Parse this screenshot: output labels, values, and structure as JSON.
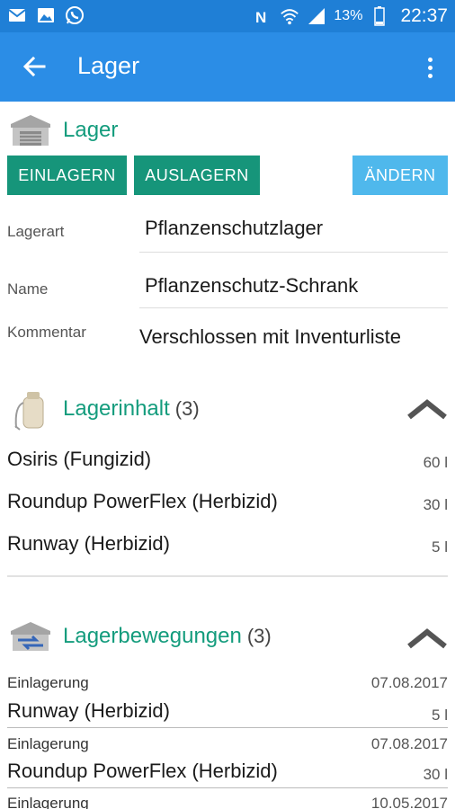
{
  "status_bar": {
    "battery": "13%",
    "time": "22:37",
    "left_icons": [
      "mail-icon",
      "image-icon",
      "whatsapp-icon"
    ],
    "right_icons": [
      "nfc-icon",
      "wifi-icon",
      "signal-icon",
      "battery-icon"
    ]
  },
  "app_bar": {
    "title": "Lager",
    "color": "#2b8de6"
  },
  "lager": {
    "title": "Lager",
    "buttons": {
      "einlagern": "EINLAGERN",
      "auslagern": "AUSLAGERN",
      "aendern": "ÄNDERN"
    },
    "fields": [
      {
        "label": "Lagerart",
        "value": "Pflanzenschutzlager"
      },
      {
        "label": "Name",
        "value": "Pflanzenschutz-Schrank"
      },
      {
        "label": "Kommentar",
        "value": "Verschlossen mit Inventurliste"
      }
    ]
  },
  "inhalt": {
    "title": "Lagerinhalt",
    "count": "(3)",
    "items": [
      {
        "name": "Osiris (Fungizid)",
        "amount": "60 l"
      },
      {
        "name": "Roundup PowerFlex (Herbizid)",
        "amount": "30 l"
      },
      {
        "name": "Runway (Herbizid)",
        "amount": "5 l"
      }
    ]
  },
  "bewegungen": {
    "title": "Lagerbewegungen",
    "count": "(3)",
    "items": [
      {
        "type": "Einlagerung",
        "date": "07.08.2017",
        "name": "Runway (Herbizid)",
        "amount": "5 l"
      },
      {
        "type": "Einlagerung",
        "date": "07.08.2017",
        "name": "Roundup PowerFlex (Herbizid)",
        "amount": "30 l"
      },
      {
        "type": "Einlagerung",
        "date": "10.05.2017"
      }
    ]
  },
  "colors": {
    "accent_green": "#16957a",
    "title_green": "#149c7d",
    "button_blue": "#4fb8ec",
    "statusbar": "#1f7fd6"
  }
}
